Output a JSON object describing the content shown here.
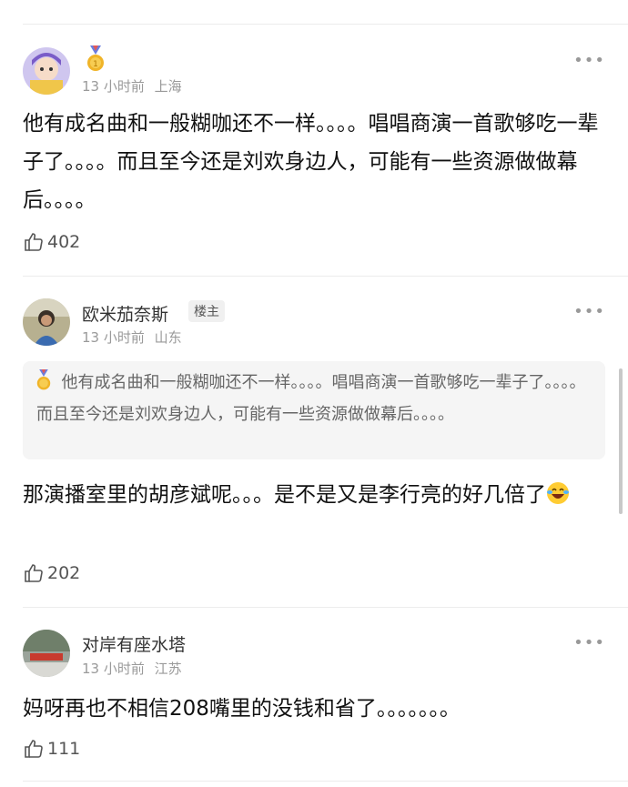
{
  "comments": [
    {
      "name": "",
      "time": "13 小时前",
      "location": "上海",
      "text": "他有成名曲和一般糊咖还不一样。。。。唱唱商演一首歌够吃一辈子了。。。。而且至今还是刘欢身边人，可能有一些资源做做幕后。。。。",
      "likes": "402"
    },
    {
      "name": "欧米茄奈斯",
      "badge": "楼主",
      "time": "13 小时前",
      "location": "山东",
      "quote": "他有成名曲和一般糊咖还不一样。。。。唱唱商演一首歌够吃一辈子了。。。。而且至今还是刘欢身边人，可能有一些资源做做幕后。。。。",
      "text": "那演播室里的胡彦斌呢。。。是不是又是李行亮的好几倍了",
      "likes": "202"
    },
    {
      "name": "对岸有座水塔",
      "time": "13 小时前",
      "location": "江苏",
      "text": "妈呀再也不相信208嘴里的没钱和省了。。。。。。。",
      "likes": "111"
    }
  ],
  "more_icon": "more-dots-icon",
  "like_icon": "thumbs-up-icon",
  "colors": {
    "meta": "#9a9a9a",
    "quote_bg": "#f5f5f5"
  }
}
